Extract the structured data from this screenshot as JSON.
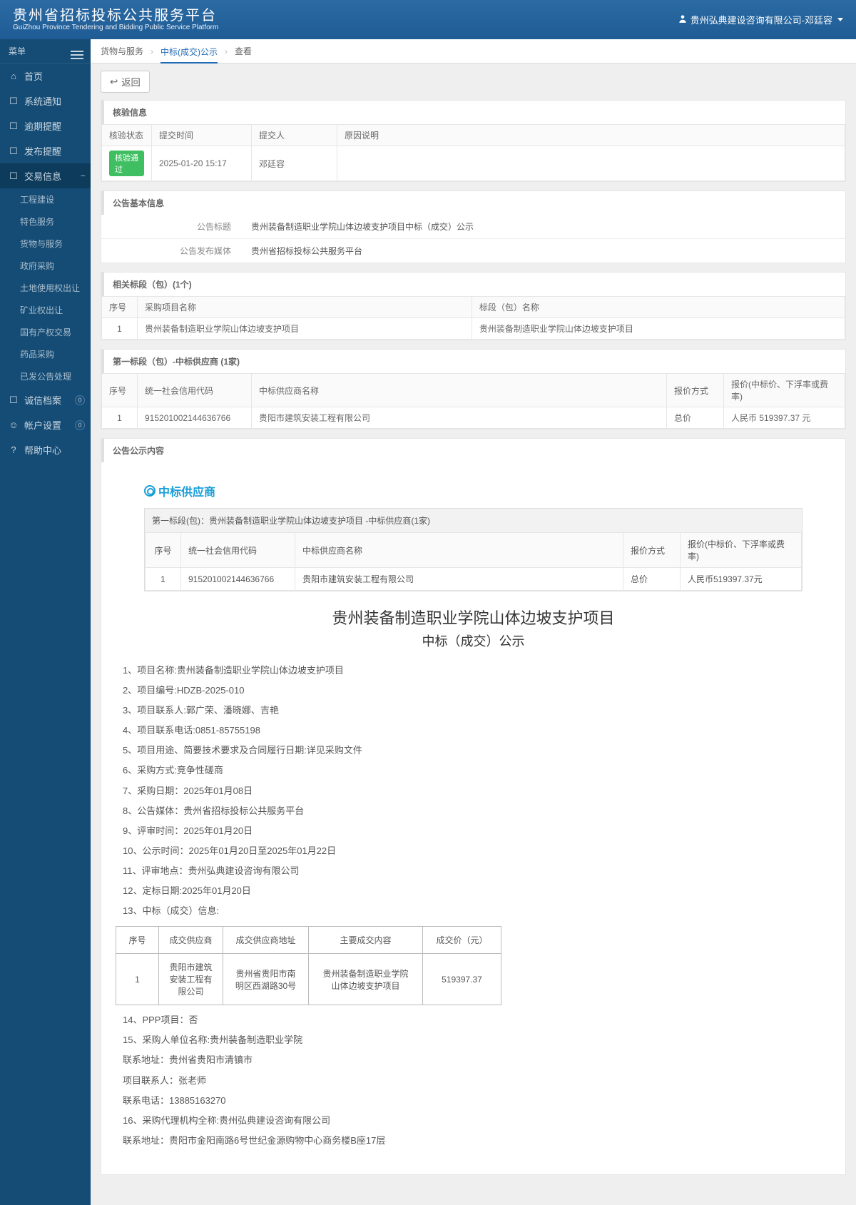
{
  "header": {
    "title_cn": "贵州省招标投标公共服务平台",
    "title_en": "GuiZhou Province Tendering and Bidding Public Service Platform",
    "user_name": "贵州弘典建设咨询有限公司-邓廷容"
  },
  "sidebar": {
    "menu_label": "菜单",
    "items": [
      {
        "label": "首页"
      },
      {
        "label": "系统通知"
      },
      {
        "label": "逾期提醒"
      },
      {
        "label": "发布提醒"
      },
      {
        "label": "交易信息",
        "expanded": true,
        "exp_icon": "–"
      },
      {
        "label": "诚信档案",
        "badge": "0"
      },
      {
        "label": "帐户设置",
        "badge": "0"
      },
      {
        "label": "帮助中心"
      }
    ],
    "sub_items": [
      "工程建设",
      "特色服务",
      "货物与服务",
      "政府采购",
      "土地使用权出让",
      "矿业权出让",
      "国有产权交易",
      "药品采购",
      "已发公告处理"
    ]
  },
  "breadcrumb": {
    "a": "货物与服务",
    "b": "中标(成交)公示",
    "c": "查看"
  },
  "buttons": {
    "back": "返回"
  },
  "audit_section": {
    "title": "核验信息",
    "status_h": "核验状态",
    "time_h": "提交时间",
    "person_h": "提交人",
    "reason_h": "原因说明",
    "row": {
      "status": "核验通过",
      "time": "2025-01-20 15:17",
      "person": "邓廷容",
      "reason": ""
    }
  },
  "basic_section": {
    "title": "公告基本信息",
    "row1_label": "公告标题",
    "row1_value": "贵州装备制造职业学院山体边坡支护项目中标（成交）公示",
    "row2_label": "公告发布媒体",
    "row2_value": "贵州省招标投标公共服务平台"
  },
  "lots_section": {
    "title": "相关标段（包）(1个)",
    "seq_h": "序号",
    "proj_h": "采购项目名称",
    "lot_h": "标段（包）名称",
    "row": {
      "seq": "1",
      "proj": "贵州装备制造职业学院山体边坡支护项目",
      "lot": "贵州装备制造职业学院山体边坡支护项目"
    }
  },
  "supplier_section": {
    "title": "第一标段（包）-中标供应商 (1家)",
    "seq_h": "序号",
    "code_h": "统一社会信用代码",
    "name_h": "中标供应商名称",
    "method_h": "报价方式",
    "price_h": "报价(中标价、下浮率或费率)",
    "row": {
      "seq": "1",
      "code": "915201002144636766",
      "name": "贵阳市建筑安装工程有限公司",
      "method": "总价",
      "price": "人民币 519397.37 元"
    }
  },
  "notice_section": {
    "title": "公告公示内容",
    "stamp": "中标供应商",
    "inner_title": "第一标段(包)：贵州装备制造职业学院山体边坡支护项目  -中标供应商(1家)",
    "inner_th": {
      "seq": "序号",
      "code": "统一社会信用代码",
      "name": "中标供应商名称",
      "method": "报价方式",
      "price": "报价(中标价、下浮率或费率)"
    },
    "inner_row": {
      "seq": "1",
      "code": "915201002144636766",
      "name": "贵阳市建筑安装工程有限公司",
      "method": "总价",
      "price": "人民币519397.37元"
    },
    "big_title": "贵州装备制造职业学院山体边坡支护项目",
    "sub_title": "中标（成交）公示",
    "paras": [
      "1、项目名称:贵州装备制造职业学院山体边坡支护项目",
      "2、项目编号:HDZB-2025-010",
      "3、项目联系人:郭广荣、潘晓娜、吉艳",
      "4、项目联系电话:0851-85755198",
      "5、项目用途、简要技术要求及合同履行日期:详见采购文件",
      "6、采购方式:竞争性磋商",
      "7、采购日期：2025年01月08日",
      "8、公告媒体：贵州省招标投标公共服务平台",
      "9、评审时间：2025年01月20日",
      "10、公示时间：2025年01月20日至2025年01月22日",
      "11、评审地点：贵州弘典建设咨询有限公司",
      "12、定标日期:2025年01月20日",
      "13、中标（成交）信息:"
    ],
    "deal_th": {
      "seq": "序号",
      "supplier": "成交供应商",
      "addr": "成交供应商地址",
      "content": "主要成交内容",
      "price": "成交价（元）"
    },
    "deal_row": {
      "seq": "1",
      "supplier": "贵阳市建筑安装工程有限公司",
      "addr": "贵州省贵阳市南明区西湖路30号",
      "content": "贵州装备制造职业学院山体边坡支护项目",
      "price": "519397.37"
    },
    "paras2": [
      "14、PPP项目：否",
      "15、采购人单位名称:贵州装备制造职业学院",
      "联系地址：贵州省贵阳市清镇市",
      "项目联系人：张老师",
      "联系电话：13885163270",
      "16、采购代理机构全称:贵州弘典建设咨询有限公司",
      "联系地址：贵阳市金阳南路6号世纪金源购物中心商务楼B座17层"
    ]
  }
}
